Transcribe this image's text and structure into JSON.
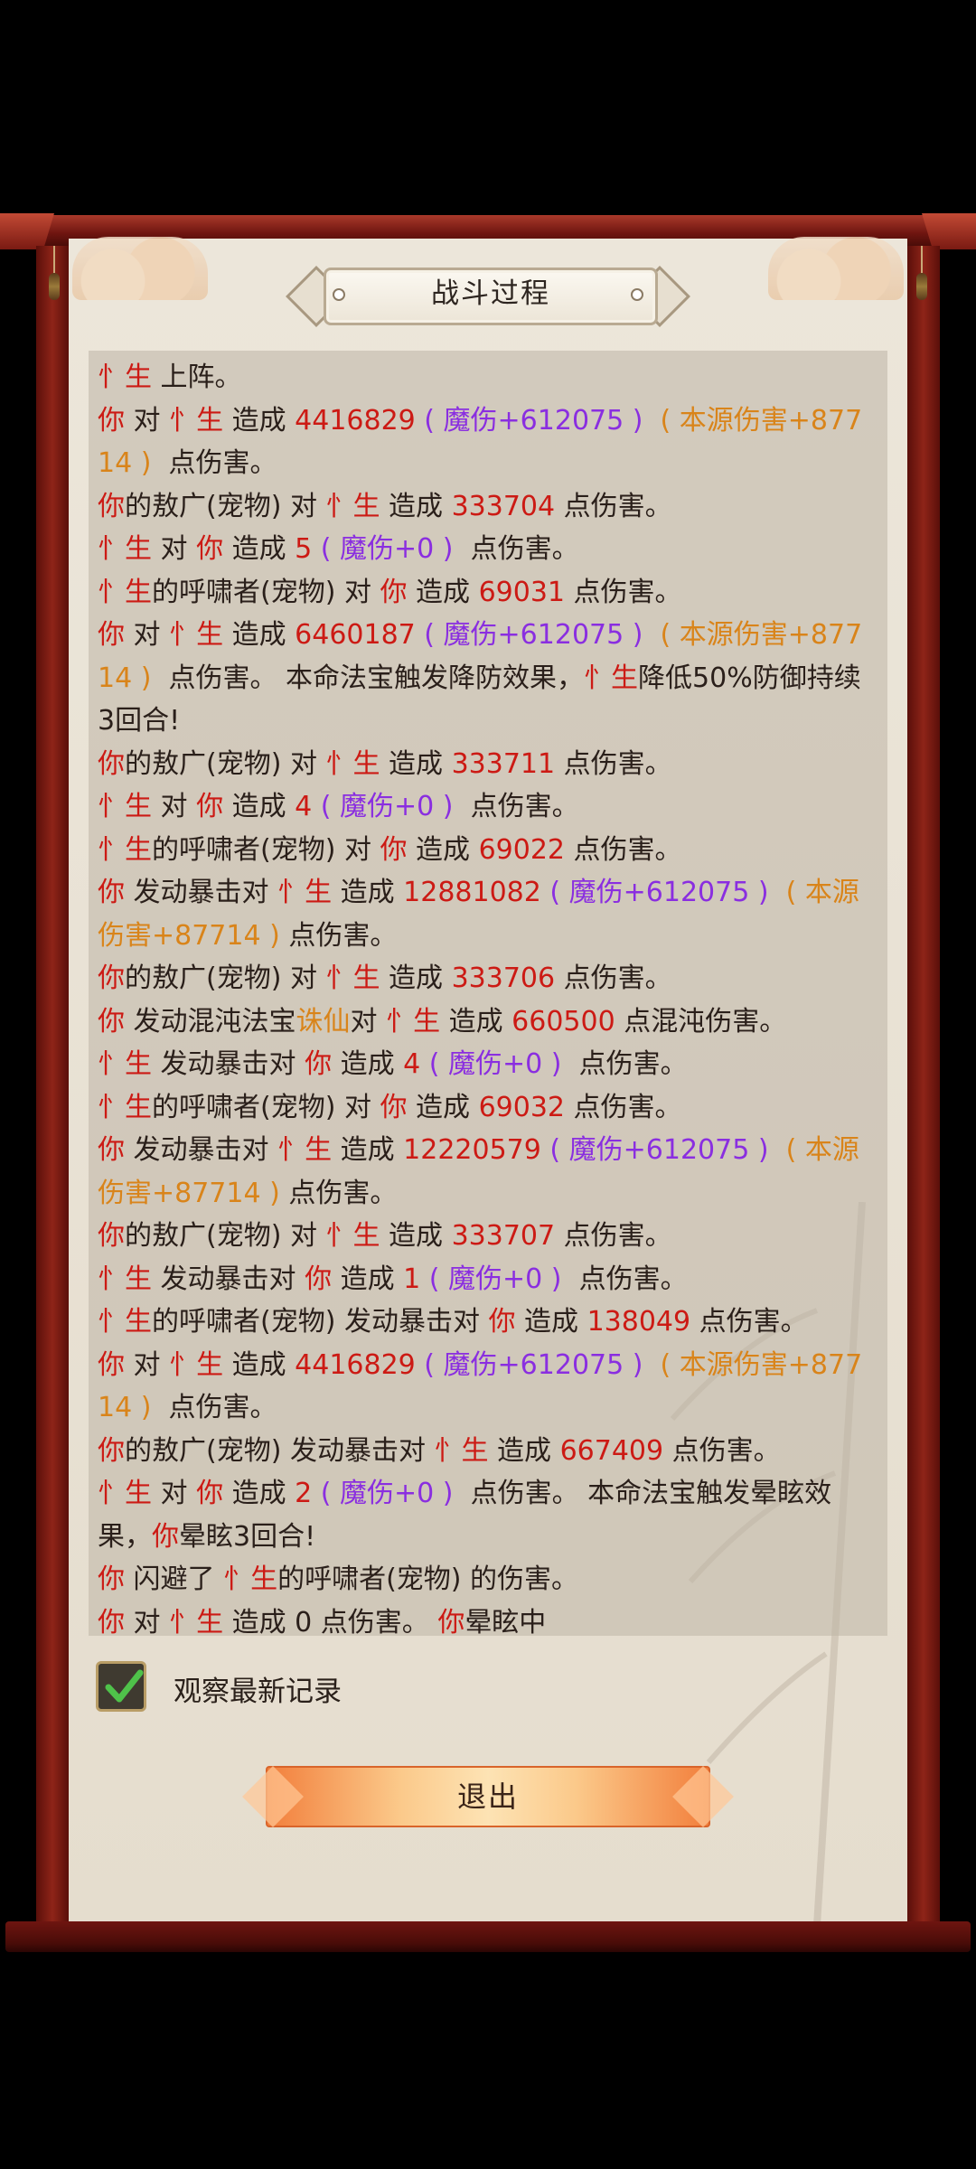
{
  "title": "战斗过程",
  "log": [
    [
      [
        "r",
        "忄生"
      ],
      [
        "k",
        " 上阵。"
      ]
    ],
    [
      [
        "r",
        "你"
      ],
      [
        "k",
        " 对 "
      ],
      [
        "r",
        "忄生"
      ],
      [
        "k",
        " 造成 "
      ],
      [
        "r",
        "4416829"
      ],
      [
        "p",
        " ( 魔伤+612075 ) "
      ],
      [
        "o",
        " ( 本源伤害+87714 ) "
      ],
      [
        "k",
        " 点伤害。"
      ]
    ],
    [
      [
        "r",
        "你"
      ],
      [
        "k",
        "的敖广(宠物) 对 "
      ],
      [
        "r",
        "忄生"
      ],
      [
        "k",
        " 造成 "
      ],
      [
        "r",
        "333704"
      ],
      [
        "k",
        " 点伤害。"
      ]
    ],
    [
      [
        "r",
        "忄生"
      ],
      [
        "k",
        " 对 "
      ],
      [
        "r",
        "你"
      ],
      [
        "k",
        " 造成 "
      ],
      [
        "r",
        "5"
      ],
      [
        "p",
        " ( 魔伤+0 ) "
      ],
      [
        "k",
        " 点伤害。"
      ]
    ],
    [
      [
        "r",
        "忄生"
      ],
      [
        "k",
        "的呼啸者(宠物) 对 "
      ],
      [
        "r",
        "你"
      ],
      [
        "k",
        " 造成 "
      ],
      [
        "r",
        "69031"
      ],
      [
        "k",
        " 点伤害。"
      ]
    ],
    [
      [
        "r",
        "你"
      ],
      [
        "k",
        " 对 "
      ],
      [
        "r",
        "忄生"
      ],
      [
        "k",
        " 造成 "
      ],
      [
        "r",
        "6460187"
      ],
      [
        "p",
        " ( 魔伤+612075 ) "
      ],
      [
        "o",
        " ( 本源伤害+87714 ) "
      ],
      [
        "k",
        " 点伤害。 本命法宝触发降防效果，"
      ],
      [
        "r",
        "忄生"
      ],
      [
        "k",
        "降低50%防御持续3回合!"
      ]
    ],
    [
      [
        "r",
        "你"
      ],
      [
        "k",
        "的敖广(宠物) 对 "
      ],
      [
        "r",
        "忄生"
      ],
      [
        "k",
        " 造成 "
      ],
      [
        "r",
        "333711"
      ],
      [
        "k",
        " 点伤害。"
      ]
    ],
    [
      [
        "r",
        "忄生"
      ],
      [
        "k",
        " 对 "
      ],
      [
        "r",
        "你"
      ],
      [
        "k",
        " 造成 "
      ],
      [
        "r",
        "4"
      ],
      [
        "p",
        " ( 魔伤+0 ) "
      ],
      [
        "k",
        " 点伤害。"
      ]
    ],
    [
      [
        "r",
        "忄生"
      ],
      [
        "k",
        "的呼啸者(宠物) 对 "
      ],
      [
        "r",
        "你"
      ],
      [
        "k",
        " 造成 "
      ],
      [
        "r",
        "69022"
      ],
      [
        "k",
        " 点伤害。"
      ]
    ],
    [
      [
        "r",
        "你"
      ],
      [
        "k",
        " 发动暴击对 "
      ],
      [
        "r",
        "忄生"
      ],
      [
        "k",
        " 造成 "
      ],
      [
        "r",
        "12881082"
      ],
      [
        "p",
        " ( 魔伤+612075 ) "
      ],
      [
        "o",
        " ( 本源伤害+87714 ) "
      ],
      [
        "k",
        "点伤害。"
      ]
    ],
    [
      [
        "r",
        "你"
      ],
      [
        "k",
        "的敖广(宠物) 对 "
      ],
      [
        "r",
        "忄生"
      ],
      [
        "k",
        " 造成 "
      ],
      [
        "r",
        "333706"
      ],
      [
        "k",
        " 点伤害。"
      ]
    ],
    [
      [
        "r",
        "你"
      ],
      [
        "k",
        " 发动混沌法宝"
      ],
      [
        "o",
        "诛仙"
      ],
      [
        "k",
        "对 "
      ],
      [
        "r",
        "忄生"
      ],
      [
        "k",
        " 造成 "
      ],
      [
        "r",
        "660500"
      ],
      [
        "k",
        " 点混沌伤害。"
      ]
    ],
    [
      [
        "r",
        "忄生"
      ],
      [
        "k",
        " 发动暴击对 "
      ],
      [
        "r",
        "你"
      ],
      [
        "k",
        " 造成 "
      ],
      [
        "r",
        "4"
      ],
      [
        "p",
        " ( 魔伤+0 ) "
      ],
      [
        "k",
        " 点伤害。"
      ]
    ],
    [
      [
        "r",
        "忄生"
      ],
      [
        "k",
        "的呼啸者(宠物) 对 "
      ],
      [
        "r",
        "你"
      ],
      [
        "k",
        " 造成 "
      ],
      [
        "r",
        "69032"
      ],
      [
        "k",
        " 点伤害。"
      ]
    ],
    [
      [
        "r",
        "你"
      ],
      [
        "k",
        " 发动暴击对 "
      ],
      [
        "r",
        "忄生"
      ],
      [
        "k",
        " 造成 "
      ],
      [
        "r",
        "12220579"
      ],
      [
        "p",
        " ( 魔伤+612075 ) "
      ],
      [
        "o",
        " ( 本源伤害+87714 ) "
      ],
      [
        "k",
        "点伤害。"
      ]
    ],
    [
      [
        "r",
        "你"
      ],
      [
        "k",
        "的敖广(宠物) 对 "
      ],
      [
        "r",
        "忄生"
      ],
      [
        "k",
        " 造成 "
      ],
      [
        "r",
        "333707"
      ],
      [
        "k",
        " 点伤害。"
      ]
    ],
    [
      [
        "r",
        "忄生"
      ],
      [
        "k",
        " 发动暴击对 "
      ],
      [
        "r",
        "你"
      ],
      [
        "k",
        " 造成 "
      ],
      [
        "r",
        "1"
      ],
      [
        "p",
        " ( 魔伤+0 ) "
      ],
      [
        "k",
        " 点伤害。"
      ]
    ],
    [
      [
        "r",
        "忄生"
      ],
      [
        "k",
        "的呼啸者(宠物) 发动暴击对 "
      ],
      [
        "r",
        "你"
      ],
      [
        "k",
        " 造成 "
      ],
      [
        "r",
        "138049"
      ],
      [
        "k",
        " 点伤害。"
      ]
    ],
    [
      [
        "r",
        "你"
      ],
      [
        "k",
        " 对 "
      ],
      [
        "r",
        "忄生"
      ],
      [
        "k",
        " 造成 "
      ],
      [
        "r",
        "4416829"
      ],
      [
        "p",
        " ( 魔伤+612075 ) "
      ],
      [
        "o",
        " ( 本源伤害+87714 ) "
      ],
      [
        "k",
        " 点伤害。"
      ]
    ],
    [
      [
        "r",
        "你"
      ],
      [
        "k",
        "的敖广(宠物) 发动暴击对 "
      ],
      [
        "r",
        "忄生"
      ],
      [
        "k",
        " 造成 "
      ],
      [
        "r",
        "667409"
      ],
      [
        "k",
        " 点伤害。"
      ]
    ],
    [
      [
        "r",
        "忄生"
      ],
      [
        "k",
        " 对 "
      ],
      [
        "r",
        "你"
      ],
      [
        "k",
        " 造成 "
      ],
      [
        "r",
        "2"
      ],
      [
        "p",
        " ( 魔伤+0 ) "
      ],
      [
        "k",
        " 点伤害。 本命法宝触发晕眩效果，"
      ],
      [
        "r",
        "你"
      ],
      [
        "k",
        "晕眩3回合!"
      ]
    ],
    [
      [
        "r",
        "你"
      ],
      [
        "k",
        " 闪避了 "
      ],
      [
        "r",
        "忄生"
      ],
      [
        "k",
        "的呼啸者(宠物) 的伤害。"
      ]
    ],
    [
      [
        "r",
        "你"
      ],
      [
        "k",
        " 对 "
      ],
      [
        "r",
        "忄生"
      ],
      [
        "k",
        " 造成 0 点伤害。 "
      ],
      [
        "r",
        "你"
      ],
      [
        "k",
        "晕眩中"
      ]
    ]
  ],
  "checkbox": {
    "label": "观察最新记录",
    "checked": true
  },
  "exit_label": "退出"
}
